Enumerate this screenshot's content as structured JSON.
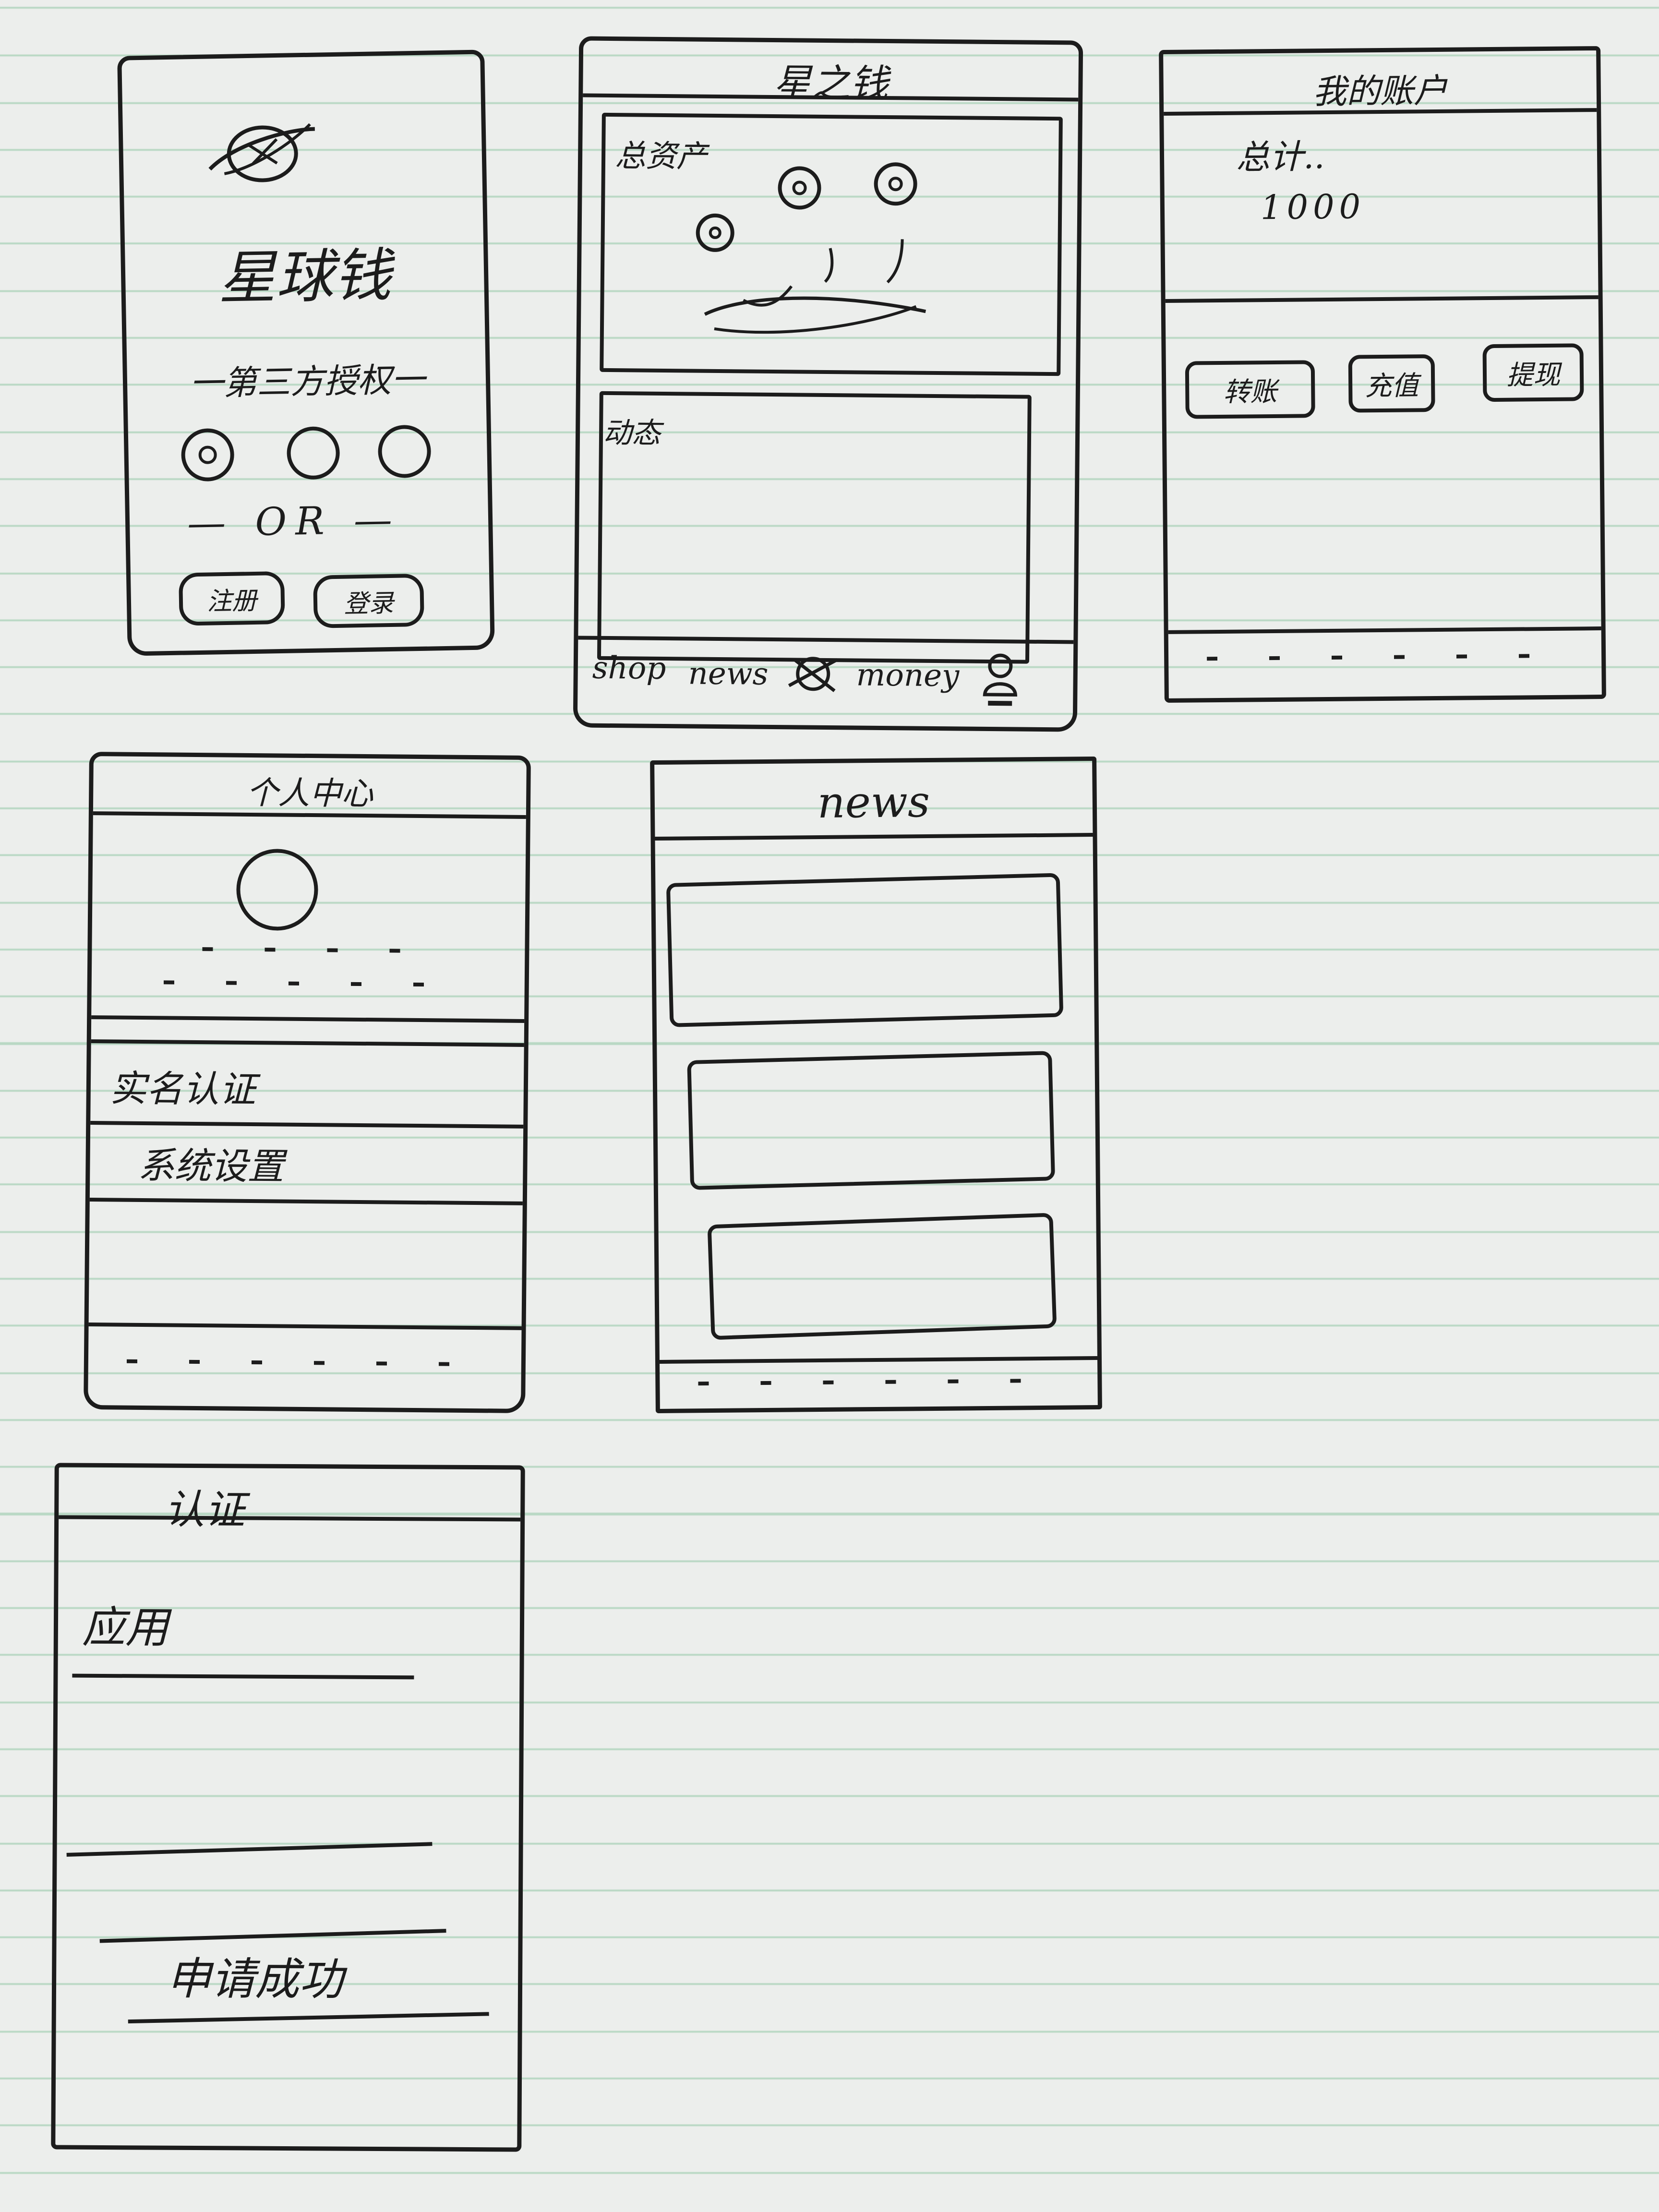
{
  "login": {
    "logo_icon": "planet-logo-icon",
    "app_name": "星球钱",
    "third_party_label": "一第三方授权一",
    "or_label": "— OR —",
    "btn_left": "注册",
    "btn_right": "登录"
  },
  "home": {
    "title": "星之钱",
    "assets_label": "总资产",
    "posts_label": "动态",
    "tabs": [
      "shop",
      "news",
      "money"
    ]
  },
  "account": {
    "title": "我的账户",
    "total_label": "总计..",
    "amount": "1000",
    "buttons": [
      "转账",
      "充值",
      "提现"
    ]
  },
  "profile": {
    "title": "个人中心",
    "menu": [
      "实名认证",
      "系统设置"
    ]
  },
  "news": {
    "title": "news"
  },
  "verify": {
    "title": "认证",
    "field_label": "应用",
    "submit_label": "申请成功"
  }
}
